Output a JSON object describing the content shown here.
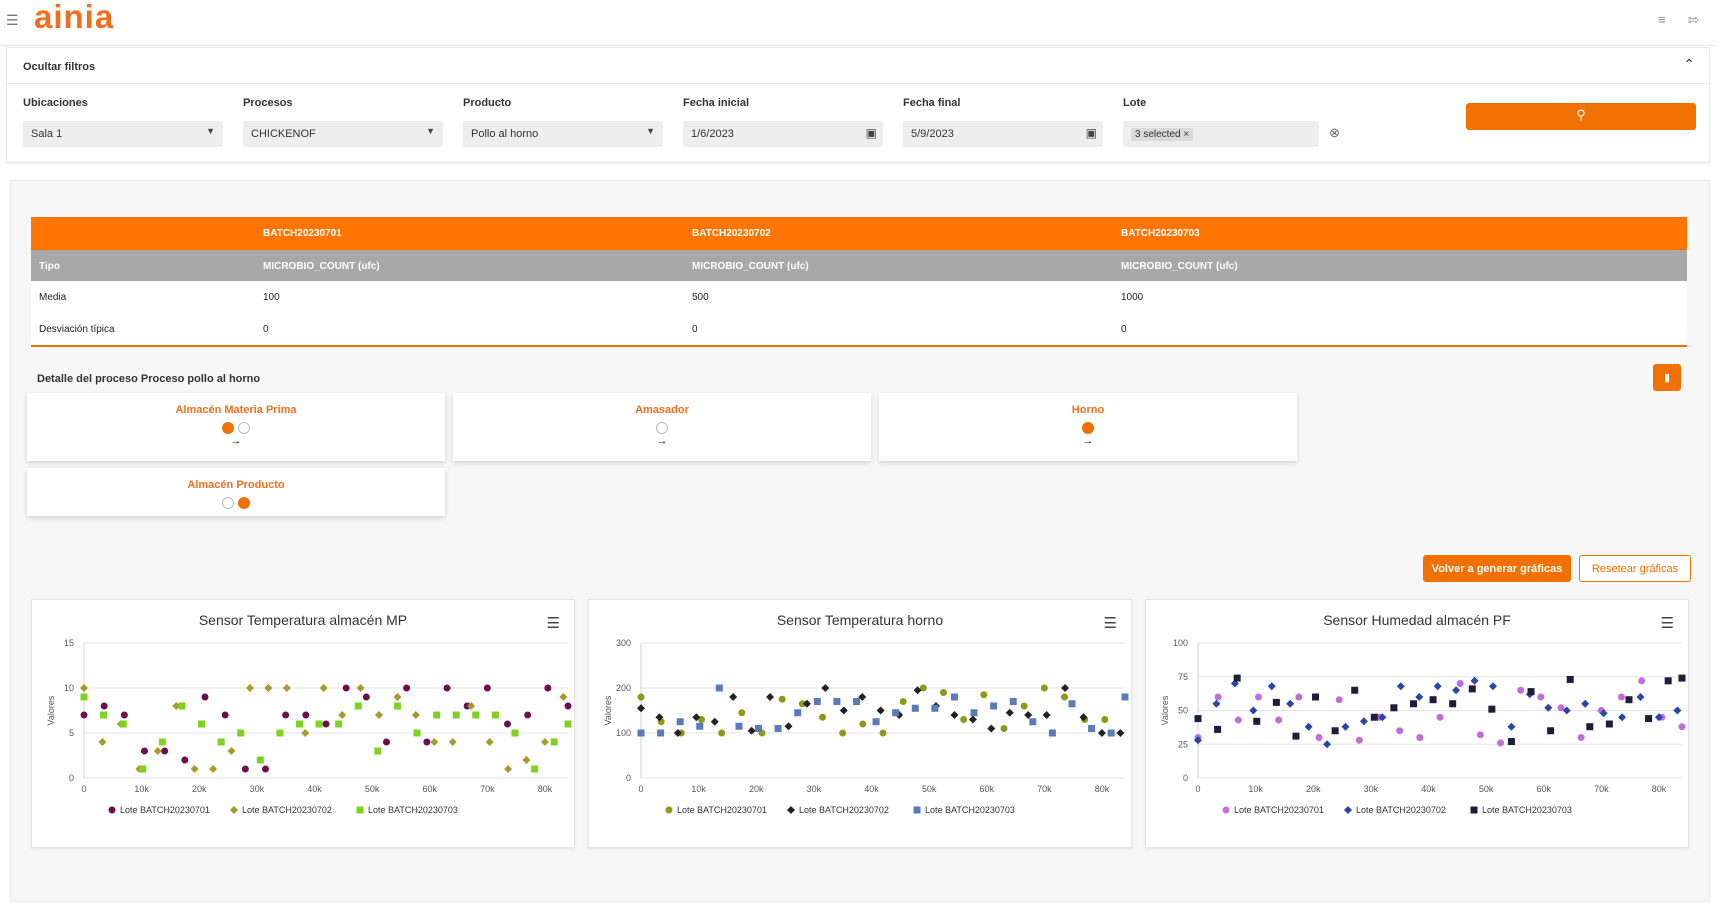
{
  "app": {
    "logo": "ainia",
    "menu_icon": "hamburger-icon"
  },
  "header": {
    "right_icons": [
      "list-icon",
      "logout-icon"
    ]
  },
  "filters": {
    "toggle_label": "Ocultar filtros",
    "ubicaciones": {
      "label": "Ubicaciones",
      "value": "Sala 1"
    },
    "procesos": {
      "label": "Procesos",
      "value": "CHICKENOF"
    },
    "producto": {
      "label": "Producto",
      "value": "Pollo al horno"
    },
    "fecha_inicial": {
      "label": "Fecha inicial",
      "value": "1/6/2023"
    },
    "fecha_final": {
      "label": "Fecha final",
      "value": "5/9/2023"
    },
    "lote": {
      "label": "Lote",
      "tag": "3 selected"
    },
    "search_icon": "search-icon"
  },
  "summary_table": {
    "batches": [
      "BATCH20230701",
      "BATCH20230702",
      "BATCH20230703"
    ],
    "rows": [
      {
        "label": "Tipo",
        "values": [
          "MICROBIO_COUNT (ufc)",
          "MICROBIO_COUNT (ufc)",
          "MICROBIO_COUNT (ufc)"
        ]
      },
      {
        "label": "Media",
        "values": [
          "100",
          "500",
          "1000"
        ]
      },
      {
        "label": "Desviación típica",
        "values": [
          "0",
          "0",
          "0"
        ]
      }
    ]
  },
  "process": {
    "title": "Detalle del proceso Proceso pollo al horno",
    "stages": [
      {
        "name": "Almacén Materia Prima",
        "dots": [
          "on",
          "off"
        ],
        "arrow": "→"
      },
      {
        "name": "Amasador",
        "dots": [
          "off"
        ],
        "arrow": "→"
      },
      {
        "name": "Horno",
        "dots": [
          "on"
        ],
        "arrow": "→"
      },
      {
        "name": "Almacén Producto",
        "dots": [
          "off",
          "on"
        ],
        "arrow": ""
      }
    ]
  },
  "actions": {
    "regenerate": "Volver a generar gráficas",
    "reset": "Resetear gráficas"
  },
  "chart_data": [
    {
      "type": "scatter",
      "title": "Sensor Temperatura almacén MP",
      "ylabel": "Valores",
      "ylim": [
        0,
        15
      ],
      "yticks": [
        0,
        5,
        10,
        15
      ],
      "xlim": [
        0,
        84000
      ],
      "xticks": [
        "0",
        "10k",
        "20k",
        "30k",
        "40k",
        "50k",
        "60k",
        "70k",
        "80k"
      ],
      "series": [
        {
          "name": "Lote BATCH20230701",
          "color": "#6b0f4f",
          "marker": "circle",
          "x": [
            0,
            3500,
            7000,
            10500,
            14000,
            17500,
            21000,
            24500,
            28000,
            31500,
            35000,
            38500,
            42000,
            45500,
            49000,
            52500,
            56000,
            59500,
            63000,
            66500,
            70000,
            73500,
            77000,
            80500,
            84000
          ],
          "y": [
            7,
            8,
            7,
            3,
            3,
            2,
            9,
            7,
            1,
            1,
            7,
            7,
            6,
            10,
            9,
            4,
            10,
            4,
            10,
            8,
            10,
            6,
            7,
            10,
            8
          ]
        },
        {
          "name": "Lote BATCH20230702",
          "color": "#a89a2a",
          "marker": "diamond",
          "x": [
            0,
            3200,
            6400,
            9600,
            12800,
            16000,
            19200,
            22400,
            25600,
            28800,
            32000,
            35200,
            38400,
            41600,
            44800,
            48000,
            51200,
            54400,
            57600,
            60800,
            64000,
            67200,
            70400,
            73600,
            76800,
            80000,
            83200
          ],
          "y": [
            10,
            4,
            6,
            1,
            3,
            8,
            1,
            1,
            3,
            10,
            10,
            10,
            5,
            10,
            7,
            10,
            7,
            9,
            7,
            4,
            4,
            8,
            4,
            1,
            2,
            4,
            9
          ]
        },
        {
          "name": "Lote BATCH20230703",
          "color": "#7ed321",
          "marker": "square",
          "x": [
            0,
            3400,
            6800,
            10200,
            13600,
            17000,
            20400,
            23800,
            27200,
            30600,
            34000,
            37400,
            40800,
            44200,
            47600,
            51000,
            54400,
            57800,
            61200,
            64600,
            68000,
            71400,
            74800,
            78200,
            81600,
            84000
          ],
          "y": [
            9,
            7,
            6,
            1,
            4,
            8,
            6,
            4,
            5,
            2,
            5,
            6,
            6,
            6,
            8,
            3,
            8,
            5,
            7,
            7,
            7,
            7,
            5,
            1,
            4,
            6
          ]
        }
      ]
    },
    {
      "type": "scatter",
      "title": "Sensor Temperatura horno",
      "ylabel": "Valores",
      "ylim": [
        0,
        300
      ],
      "yticks": [
        0,
        100,
        200,
        300
      ],
      "xlim": [
        0,
        84000
      ],
      "xticks": [
        "0",
        "10k",
        "20k",
        "30k",
        "40k",
        "50k",
        "60k",
        "70k",
        "80k"
      ],
      "series": [
        {
          "name": "Lote BATCH20230701",
          "color": "#8a9a1a",
          "marker": "circle",
          "x": [
            0,
            3500,
            7000,
            10500,
            14000,
            17500,
            21000,
            24500,
            28000,
            31500,
            35000,
            38500,
            42000,
            45500,
            49000,
            52500,
            56000,
            59500,
            63000,
            66500,
            70000,
            73500,
            77000,
            80500
          ],
          "y": [
            180,
            125,
            100,
            130,
            100,
            145,
            100,
            175,
            165,
            135,
            100,
            120,
            100,
            170,
            200,
            190,
            130,
            185,
            110,
            160,
            200,
            180,
            130,
            130
          ]
        },
        {
          "name": "Lote BATCH20230702",
          "color": "#222222",
          "marker": "diamond",
          "x": [
            0,
            3200,
            6400,
            9600,
            12800,
            16000,
            19200,
            22400,
            25600,
            28800,
            32000,
            35200,
            38400,
            41600,
            44800,
            48000,
            51200,
            54400,
            57600,
            60800,
            64000,
            67200,
            70400,
            73600,
            76800,
            80000,
            83200
          ],
          "y": [
            155,
            135,
            100,
            135,
            125,
            180,
            105,
            180,
            115,
            165,
            200,
            150,
            180,
            150,
            140,
            195,
            160,
            140,
            130,
            110,
            145,
            140,
            140,
            200,
            135,
            100,
            100
          ]
        },
        {
          "name": "Lote BATCH20230703",
          "color": "#5a7ab8",
          "marker": "square",
          "x": [
            0,
            3400,
            6800,
            10200,
            13600,
            17000,
            20400,
            23800,
            27200,
            30600,
            34000,
            37400,
            40800,
            44200,
            47600,
            51000,
            54400,
            57800,
            61200,
            64600,
            68000,
            71400,
            74800,
            78200,
            81600,
            84000
          ],
          "y": [
            100,
            100,
            125,
            115,
            200,
            115,
            110,
            110,
            145,
            170,
            170,
            170,
            125,
            145,
            155,
            155,
            180,
            145,
            160,
            170,
            125,
            100,
            165,
            110,
            100,
            180
          ]
        }
      ]
    },
    {
      "type": "scatter",
      "title": "Sensor Humedad almacén PF",
      "ylabel": "Valores",
      "ylim": [
        0,
        100
      ],
      "yticks": [
        0,
        25,
        50,
        75,
        100
      ],
      "xlim": [
        0,
        84000
      ],
      "xticks": [
        "0",
        "10k",
        "20k",
        "30k",
        "40k",
        "50k",
        "60k",
        "70k",
        "80k"
      ],
      "series": [
        {
          "name": "Lote BATCH20230701",
          "color": "#c36bd6",
          "marker": "circle",
          "x": [
            0,
            3500,
            7000,
            10500,
            14000,
            17500,
            21000,
            24500,
            28000,
            31500,
            35000,
            38500,
            42000,
            45500,
            49000,
            52500,
            56000,
            59500,
            63000,
            66500,
            70000,
            73500,
            77000,
            80500,
            84000
          ],
          "y": [
            30,
            60,
            43,
            60,
            43,
            60,
            30,
            58,
            28,
            45,
            35,
            30,
            45,
            70,
            32,
            26,
            65,
            60,
            52,
            30,
            50,
            60,
            72,
            45,
            38
          ]
        },
        {
          "name": "Lote BATCH20230702",
          "color": "#2845a8",
          "marker": "diamond",
          "x": [
            0,
            3200,
            6400,
            9600,
            12800,
            16000,
            19200,
            22400,
            25600,
            28800,
            32000,
            35200,
            38400,
            41600,
            44800,
            48000,
            51200,
            54400,
            57600,
            60800,
            64000,
            67200,
            70400,
            73600,
            76800,
            80000,
            83200
          ],
          "y": [
            28,
            55,
            70,
            50,
            68,
            55,
            38,
            25,
            38,
            42,
            45,
            68,
            60,
            68,
            65,
            72,
            68,
            38,
            62,
            52,
            50,
            55,
            48,
            45,
            60,
            45,
            50
          ]
        },
        {
          "name": "Lote BATCH20230703",
          "color": "#1e1e3a",
          "marker": "square",
          "x": [
            0,
            3400,
            6800,
            10200,
            13600,
            17000,
            20400,
            23800,
            27200,
            30600,
            34000,
            37400,
            40800,
            44200,
            47600,
            51000,
            54400,
            57800,
            61200,
            64600,
            68000,
            71400,
            74800,
            78200,
            81600,
            84000
          ],
          "y": [
            44,
            36,
            74,
            42,
            56,
            31,
            60,
            35,
            65,
            45,
            52,
            55,
            58,
            55,
            66,
            51,
            27,
            64,
            35,
            73,
            38,
            40,
            58,
            44,
            72,
            74
          ]
        }
      ]
    }
  ]
}
